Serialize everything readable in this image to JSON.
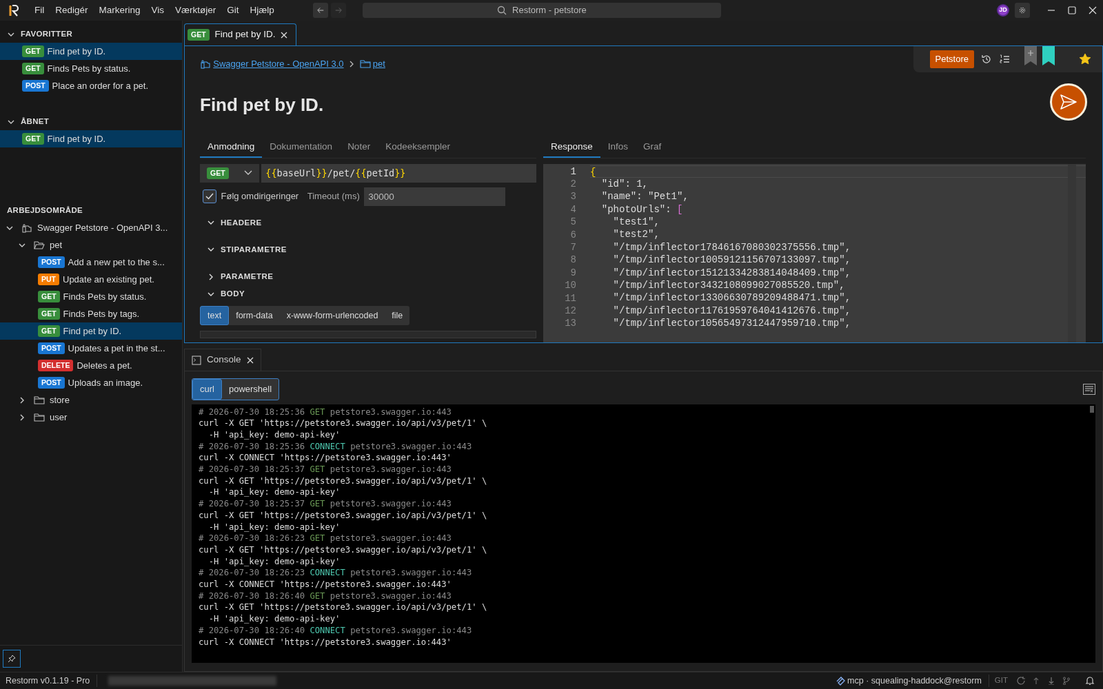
{
  "window": {
    "title": "Restorm - petstore"
  },
  "menu": [
    "Fil",
    "Redigér",
    "Markering",
    "Vis",
    "Værktøjer",
    "Git",
    "Hjælp"
  ],
  "user": {
    "initials": "JD"
  },
  "sidebar": {
    "favorites": {
      "title": "FAVORITTER",
      "expanded": true,
      "items": [
        {
          "method": "GET",
          "color": "#388e3c",
          "label": "Find pet by ID.",
          "selected": true
        },
        {
          "method": "GET",
          "color": "#388e3c",
          "label": "Finds Pets by status.",
          "selected": false
        },
        {
          "method": "POST",
          "color": "#1976d2",
          "label": "Place an order for a pet.",
          "selected": false
        }
      ]
    },
    "opened": {
      "title": "ÅBNET",
      "expanded": true,
      "items": [
        {
          "method": "GET",
          "color": "#388e3c",
          "label": "Find pet by ID.",
          "selected": true
        }
      ]
    },
    "workspace": {
      "title": "ARBEJDSOMRÅDE",
      "tree": [
        {
          "kind": "collection",
          "label": "Swagger Petstore - OpenAPI 3...",
          "expanded": true,
          "children": [
            {
              "kind": "folder",
              "label": "pet",
              "expanded": true,
              "children": [
                {
                  "kind": "request",
                  "method": "POST",
                  "color": "#1976d2",
                  "label": "Add a new pet to the s...",
                  "selected": false
                },
                {
                  "kind": "request",
                  "method": "PUT",
                  "color": "#f57c00",
                  "label": "Update an existing pet.",
                  "selected": false
                },
                {
                  "kind": "request",
                  "method": "GET",
                  "color": "#388e3c",
                  "label": "Finds Pets by status.",
                  "selected": false
                },
                {
                  "kind": "request",
                  "method": "GET",
                  "color": "#388e3c",
                  "label": "Finds Pets by tags.",
                  "selected": false
                },
                {
                  "kind": "request",
                  "method": "GET",
                  "color": "#388e3c",
                  "label": "Find pet by ID.",
                  "selected": true
                },
                {
                  "kind": "request",
                  "method": "POST",
                  "color": "#1976d2",
                  "label": "Updates a pet in the st...",
                  "selected": false
                },
                {
                  "kind": "request",
                  "method": "DELETE",
                  "color": "#d32f2f",
                  "label": "Deletes a pet.",
                  "selected": false
                },
                {
                  "kind": "request",
                  "method": "POST",
                  "color": "#1976d2",
                  "label": "Uploads an image.",
                  "selected": false
                }
              ]
            },
            {
              "kind": "folder",
              "label": "store",
              "expanded": false
            },
            {
              "kind": "folder",
              "label": "user",
              "expanded": false
            }
          ]
        }
      ]
    }
  },
  "editor": {
    "tab": {
      "method": "GET",
      "color": "#388e3c",
      "label": "Find pet by ID.",
      "selected": true
    },
    "breadcrumb": [
      "Swagger Petstore - OpenAPI 3.0",
      "pet"
    ],
    "title": "Find pet by ID.",
    "environment": "Petstore",
    "favorite": true,
    "request_tabs": [
      {
        "label": "Anmodning",
        "selected": true
      },
      {
        "label": "Dokumentation",
        "selected": false
      },
      {
        "label": "Noter",
        "selected": false
      },
      {
        "label": "Kodeeksempler",
        "selected": false
      }
    ],
    "response_tabs": [
      {
        "label": "Response",
        "selected": true
      },
      {
        "label": "Infos",
        "selected": false
      },
      {
        "label": "Graf",
        "selected": false
      }
    ],
    "method": {
      "label": "GET",
      "color": "#388e3c"
    },
    "url": [
      {
        "text": "{{",
        "kind": "brace"
      },
      {
        "text": "baseUrl",
        "kind": "plain"
      },
      {
        "text": "}}",
        "kind": "brace"
      },
      {
        "text": "/pet/",
        "kind": "plain"
      },
      {
        "text": "{{",
        "kind": "brace"
      },
      {
        "text": "petId",
        "kind": "plain"
      },
      {
        "text": "}}",
        "kind": "brace"
      }
    ],
    "follow_redirects": {
      "label": "Følg omdirigeringer",
      "checked": true
    },
    "timeout": {
      "label": "Timeout (ms)",
      "value": "30000"
    },
    "sections": [
      {
        "title": "HEADERE",
        "expanded": true
      },
      {
        "title": "STIPARAMETRE",
        "expanded": true
      },
      {
        "title": "PARAMETRE",
        "expanded": false
      },
      {
        "title": "BODY",
        "expanded": true
      }
    ],
    "body_types": [
      {
        "label": "text",
        "selected": true
      },
      {
        "label": "form-data",
        "selected": false
      },
      {
        "label": "x-www-form-urlencoded",
        "selected": false
      },
      {
        "label": "file",
        "selected": false
      }
    ],
    "response_lines": [
      {
        "number": "1",
        "bracket": "{",
        "color": "#ffd700"
      },
      {
        "number": "2",
        "text": "  \"id\": 1,"
      },
      {
        "number": "3",
        "text": "  \"name\": \"Pet1\","
      },
      {
        "number": "4",
        "text": "  \"photoUrls\": ",
        "bracket": "[",
        "color": "#da70d6"
      },
      {
        "number": "5",
        "text": "    \"test1\","
      },
      {
        "number": "6",
        "text": "    \"test2\","
      },
      {
        "number": "7",
        "text": "    \"/tmp/inflector17846167080302375556.tmp\","
      },
      {
        "number": "8",
        "text": "    \"/tmp/inflector10059121156707133097.tmp\","
      },
      {
        "number": "9",
        "text": "    \"/tmp/inflector15121334283814048409.tmp\","
      },
      {
        "number": "10",
        "text": "    \"/tmp/inflector3432108099027085520.tmp\","
      },
      {
        "number": "11",
        "text": "    \"/tmp/inflector13306630789209488471.tmp\","
      },
      {
        "number": "12",
        "text": "    \"/tmp/inflector11761959764041412676.tmp\","
      },
      {
        "number": "13",
        "text": "    \"/tmp/inflector10565497312447959710.tmp\","
      }
    ]
  },
  "console": {
    "tab": {
      "label": "Console"
    },
    "shells": [
      {
        "label": "curl",
        "selected": true
      },
      {
        "label": "powershell",
        "selected": false
      }
    ],
    "lines": [
      {
        "kind": "comment",
        "time": "# 2026-07-30 18:25:36",
        "method": "GET",
        "color": "#6a9955",
        "host": "petstore3.swagger.io:443"
      },
      {
        "kind": "command",
        "text": "curl -X GET 'https://petstore3.swagger.io/api/v3/pet/1' \\"
      },
      {
        "kind": "command",
        "text": "  -H 'api_key: demo-api-key'"
      },
      {
        "kind": "comment",
        "time": "# 2026-07-30 18:25:36",
        "method": "CONNECT",
        "color": "#4ec9b0",
        "host": "petstore3.swagger.io:443"
      },
      {
        "kind": "command",
        "text": "curl -X CONNECT 'https://petstore3.swagger.io:443'"
      },
      {
        "kind": "comment",
        "time": "# 2026-07-30 18:25:37",
        "method": "GET",
        "color": "#6a9955",
        "host": "petstore3.swagger.io:443"
      },
      {
        "kind": "command",
        "text": "curl -X GET 'https://petstore3.swagger.io/api/v3/pet/1' \\"
      },
      {
        "kind": "command",
        "text": "  -H 'api_key: demo-api-key'"
      },
      {
        "kind": "comment",
        "time": "# 2026-07-30 18:25:37",
        "method": "GET",
        "color": "#6a9955",
        "host": "petstore3.swagger.io:443"
      },
      {
        "kind": "command",
        "text": "curl -X GET 'https://petstore3.swagger.io/api/v3/pet/1' \\"
      },
      {
        "kind": "command",
        "text": "  -H 'api_key: demo-api-key'"
      },
      {
        "kind": "comment",
        "time": "# 2026-07-30 18:26:23",
        "method": "GET",
        "color": "#6a9955",
        "host": "petstore3.swagger.io:443"
      },
      {
        "kind": "command",
        "text": "curl -X GET 'https://petstore3.swagger.io/api/v3/pet/1' \\"
      },
      {
        "kind": "command",
        "text": "  -H 'api_key: demo-api-key'"
      },
      {
        "kind": "comment",
        "time": "# 2026-07-30 18:26:23",
        "method": "CONNECT",
        "color": "#4ec9b0",
        "host": "petstore3.swagger.io:443"
      },
      {
        "kind": "command",
        "text": "curl -X CONNECT 'https://petstore3.swagger.io:443'"
      },
      {
        "kind": "comment",
        "time": "# 2026-07-30 18:26:40",
        "method": "GET",
        "color": "#6a9955",
        "host": "petstore3.swagger.io:443"
      },
      {
        "kind": "command",
        "text": "curl -X GET 'https://petstore3.swagger.io/api/v3/pet/1' \\"
      },
      {
        "kind": "command",
        "text": "  -H 'api_key: demo-api-key'"
      },
      {
        "kind": "comment",
        "time": "# 2026-07-30 18:26:40",
        "method": "CONNECT",
        "color": "#4ec9b0",
        "host": "petstore3.swagger.io:443"
      },
      {
        "kind": "command",
        "text": "curl -X CONNECT 'https://petstore3.swagger.io:443'"
      }
    ]
  },
  "status_bar": {
    "version": "Restorm v0.1.19 - Pro",
    "mcp": "mcp · squealing-haddock@restorm",
    "git": "GIT"
  }
}
